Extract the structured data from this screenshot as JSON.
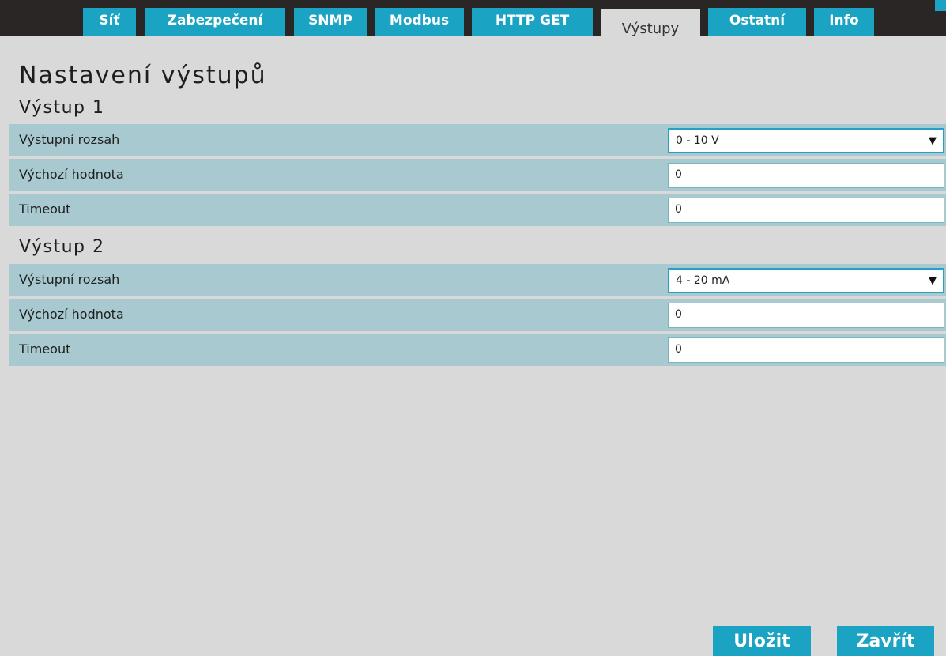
{
  "tabs": [
    {
      "label": "Síť"
    },
    {
      "label": "Zabezpečení"
    },
    {
      "label": "SNMP"
    },
    {
      "label": "Modbus"
    },
    {
      "label": "HTTP GET"
    },
    {
      "label": "Výstupy",
      "active": true
    },
    {
      "label": "Ostatní"
    },
    {
      "label": "Info"
    }
  ],
  "page_title": "Nastavení výstupů",
  "outputs": [
    {
      "title": "Výstup 1",
      "rows": [
        {
          "label": "Výstupní rozsah",
          "value": "0 - 10 V",
          "type": "select"
        },
        {
          "label": "Výchozí hodnota",
          "value": "0",
          "type": "input"
        },
        {
          "label": "Timeout",
          "value": "0",
          "type": "input"
        }
      ]
    },
    {
      "title": "Výstup 2",
      "rows": [
        {
          "label": "Výstupní rozsah",
          "value": "4 - 20 mA",
          "type": "select"
        },
        {
          "label": "Výchozí hodnota",
          "value": "0",
          "type": "input"
        },
        {
          "label": "Timeout",
          "value": "0",
          "type": "input"
        }
      ]
    }
  ],
  "buttons": {
    "save": "Uložit",
    "close": "Zavřít"
  },
  "colors": {
    "accent": "#1aa3c3",
    "topbar": "#2a2626",
    "row": "#a8c9d0",
    "background": "#d9d9d9"
  }
}
